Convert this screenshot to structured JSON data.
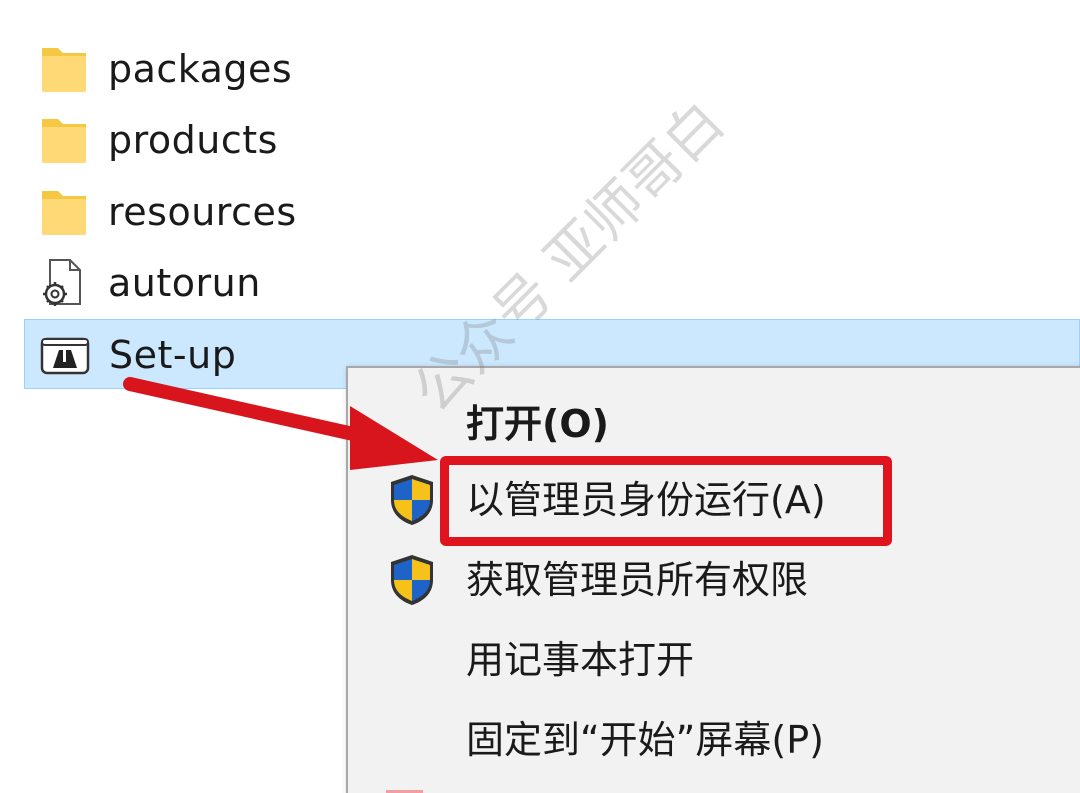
{
  "files": [
    {
      "name": "packages",
      "icon": "folder-icon"
    },
    {
      "name": "products",
      "icon": "folder-icon"
    },
    {
      "name": "resources",
      "icon": "folder-icon"
    },
    {
      "name": "autorun",
      "icon": "settings-file-icon"
    },
    {
      "name": "Set-up",
      "icon": "adobe-app-icon",
      "selected": true
    }
  ],
  "context_menu": {
    "items": [
      {
        "label": "打开(O)",
        "icon": ""
      },
      {
        "label": "以管理员身份运行(A)",
        "icon": "uac-shield-icon"
      },
      {
        "label": "获取管理员所有权限",
        "icon": "uac-shield-icon"
      },
      {
        "label": "用记事本打开",
        "icon": ""
      },
      {
        "label": "固定到“开始”屏幕(P)",
        "icon": ""
      }
    ]
  },
  "watermark": "公众号 亚师哥白",
  "colors": {
    "selection": "#cce8ff",
    "annotation_red": "#e0141e",
    "folder_yellow": "#ffd975"
  }
}
